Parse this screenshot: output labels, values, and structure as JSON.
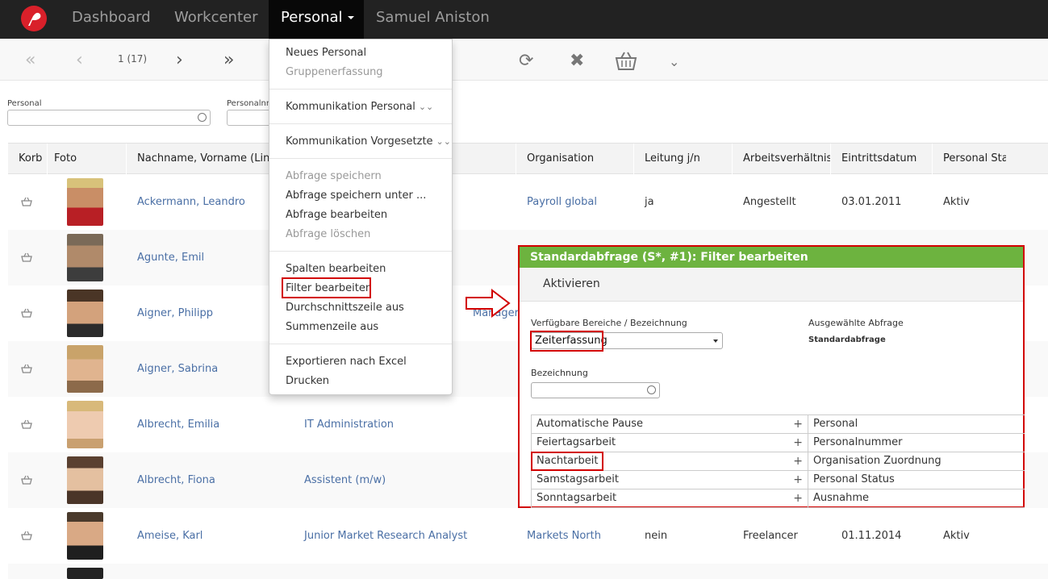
{
  "nav": {
    "items": [
      "Dashboard",
      "Workcenter",
      "Personal",
      "Samuel Aniston"
    ],
    "active": "Personal"
  },
  "toolbar": {
    "pager": "1 (17)",
    "icons": [
      "first-page-icon",
      "prev-page-icon",
      "next-page-icon",
      "last-page-icon",
      "refresh-icon",
      "close-icon",
      "basket-icon",
      "expand-icon"
    ]
  },
  "filters": {
    "personal_label": "Personal",
    "personalnr_label": "Personalnr"
  },
  "table": {
    "headers": [
      "Korb",
      "Foto",
      "Nachname, Vorname (Link)",
      "Organisation",
      "Leitung j/n",
      "Arbeitsverhältnis",
      "Eintrittsdatum",
      "Personal Status"
    ],
    "rows": [
      {
        "name": "Ackermann, Leandro",
        "position": "",
        "organisation": "Payroll global",
        "leitung": "ja",
        "arbeit": "Angestellt",
        "eintritt": "03.01.2011",
        "status": "Aktiv"
      },
      {
        "name": "Agunte, Emil",
        "position": "",
        "organisation": "",
        "leitung": "",
        "arbeit": "",
        "eintritt": "",
        "status": ""
      },
      {
        "name": "Aigner, Philipp",
        "position": "Manager, Juni",
        "organisation": "",
        "leitung": "",
        "arbeit": "",
        "eintritt": "",
        "status": ""
      },
      {
        "name": "Aigner, Sabrina",
        "position": "",
        "organisation": "",
        "leitung": "",
        "arbeit": "",
        "eintritt": "",
        "status": ""
      },
      {
        "name": "Albrecht, Emilia",
        "position": "IT Administration",
        "organisation": "",
        "leitung": "",
        "arbeit": "",
        "eintritt": "",
        "status": ""
      },
      {
        "name": "Albrecht, Fiona",
        "position": "Assistent (m/w)",
        "organisation": "",
        "leitung": "",
        "arbeit": "",
        "eintritt": "",
        "status": ""
      },
      {
        "name": "Ameise, Karl",
        "position": "Junior Market Research Analyst",
        "organisation": "Markets North",
        "leitung": "nein",
        "arbeit": "Freelancer",
        "eintritt": "01.11.2014",
        "status": "Aktiv"
      }
    ]
  },
  "menu": {
    "items": [
      {
        "label": "Neues Personal",
        "disabled": false
      },
      {
        "label": "Gruppenerfassung",
        "disabled": true
      },
      {
        "label": "Kommunikation Personal",
        "disabled": false
      },
      {
        "label": "Kommunikation Vorgesetzte",
        "disabled": false
      },
      {
        "label": "Abfrage speichern",
        "disabled": true
      },
      {
        "label": "Abfrage speichern unter ...",
        "disabled": false
      },
      {
        "label": "Abfrage bearbeiten",
        "disabled": false
      },
      {
        "label": "Abfrage löschen",
        "disabled": true
      },
      {
        "label": "Spalten bearbeiten",
        "disabled": false
      },
      {
        "label": "Filter bearbeiten",
        "disabled": false
      },
      {
        "label": "Durchschnittszeile aus",
        "disabled": false
      },
      {
        "label": "Summenzeile aus",
        "disabled": false
      },
      {
        "label": "Exportieren nach Excel",
        "disabled": false
      },
      {
        "label": "Drucken",
        "disabled": false
      }
    ]
  },
  "panel": {
    "title": "Standardabfrage (S*, #1): Filter bearbeiten",
    "activate": "Aktivieren",
    "areas_label": "Verfügbare Bereiche / Bezeichnung",
    "areas_value": "Zeiterfassung",
    "selected_label": "Ausgewählte Abfrage",
    "selected_value": "Standardabfrage",
    "bezeichnung_label": "Bezeichnung",
    "available": [
      "Automatische Pause",
      "Feiertagsarbeit",
      "Nachtarbeit",
      "Samstagsarbeit",
      "Sonntagsarbeit"
    ],
    "selected": [
      "Personal",
      "Personalnummer",
      "Organisation Zuordnung",
      "Personal Status",
      "Ausnahme"
    ]
  },
  "colors": {
    "accent": "#6db33f",
    "highlight": "#d20000",
    "link": "#4a6fa5"
  }
}
